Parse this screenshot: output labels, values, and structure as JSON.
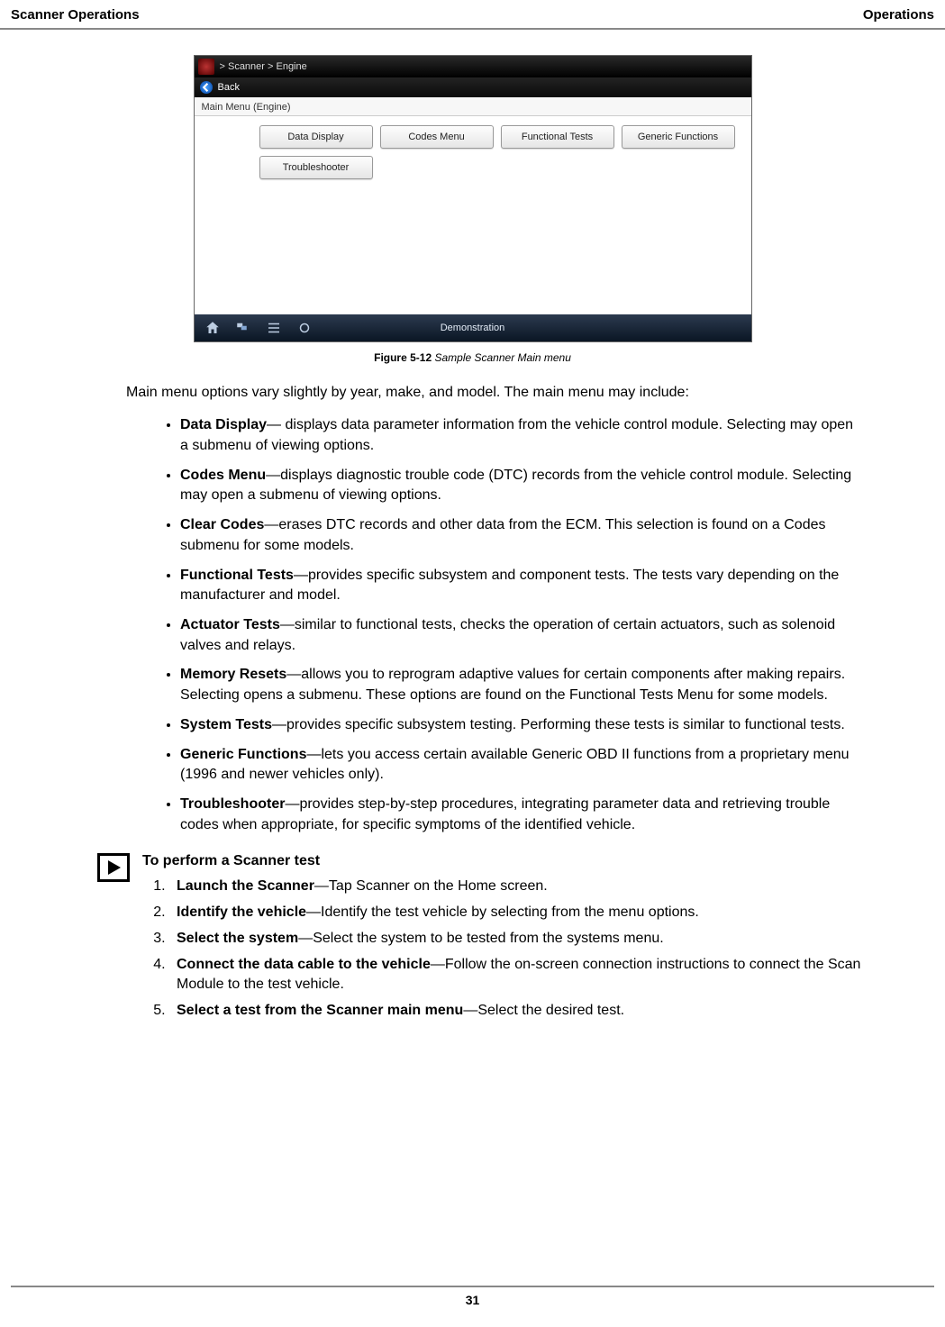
{
  "header": {
    "left": "Scanner Operations",
    "right": "Operations"
  },
  "figure": {
    "breadcrumb": "> Scanner  > Engine",
    "back_label": "Back",
    "menu_title": "Main Menu (Engine)",
    "buttons": [
      "Data Display",
      "Codes Menu",
      "Functional Tests",
      "Generic Functions",
      "Troubleshooter"
    ],
    "bottom_label": "Demonstration",
    "caption_bold": "Figure 5-12",
    "caption_italic": " Sample Scanner Main menu"
  },
  "intro_text": "Main menu options vary slightly by year, make, and model. The main menu may include:",
  "definitions": [
    {
      "term": "Data Display",
      "desc": "— displays data parameter information from the vehicle control module. Selecting may open a submenu of viewing options."
    },
    {
      "term": "Codes Menu",
      "desc": "—displays diagnostic trouble code (DTC) records from the vehicle control module. Selecting may open a submenu of viewing options."
    },
    {
      "term": "Clear Codes",
      "desc": "—erases DTC records and other data from the ECM. This selection is found on a Codes submenu for some models."
    },
    {
      "term": "Functional Tests",
      "desc": "—provides specific subsystem and component tests. The tests vary depending on the manufacturer and model."
    },
    {
      "term": "Actuator Tests",
      "desc": "—similar to functional tests, checks the operation of certain actuators, such as solenoid valves and relays."
    },
    {
      "term": "Memory Resets",
      "desc": "—allows you to reprogram adaptive values for certain components after making repairs. Selecting opens a submenu. These options are found on the Functional Tests Menu for some models."
    },
    {
      "term": "System Tests",
      "desc": "—provides specific subsystem testing. Performing these tests is similar to functional tests."
    },
    {
      "term": "Generic Functions",
      "desc": "—lets you access certain available Generic OBD II functions from a proprietary menu (1996 and newer vehicles only)."
    },
    {
      "term": "Troubleshooter",
      "desc": "—provides step-by-step procedures, integrating parameter data and retrieving trouble codes when appropriate, for specific symptoms of the identified vehicle."
    }
  ],
  "procedure": {
    "title": "To perform a Scanner test",
    "steps": [
      {
        "term": "Launch the Scanner",
        "desc": "—Tap Scanner on the Home screen."
      },
      {
        "term": "Identify the vehicle",
        "desc": "—Identify the test vehicle by selecting from the menu options."
      },
      {
        "term": "Select the system",
        "desc": "—Select the system to be tested from the systems menu."
      },
      {
        "term": "Connect the data cable to the vehicle",
        "desc": "—Follow the on-screen connection instructions to connect the Scan Module to the test vehicle."
      },
      {
        "term": "Select a test from the Scanner main menu",
        "desc": "—Select the desired test."
      }
    ]
  },
  "page_number": "31"
}
